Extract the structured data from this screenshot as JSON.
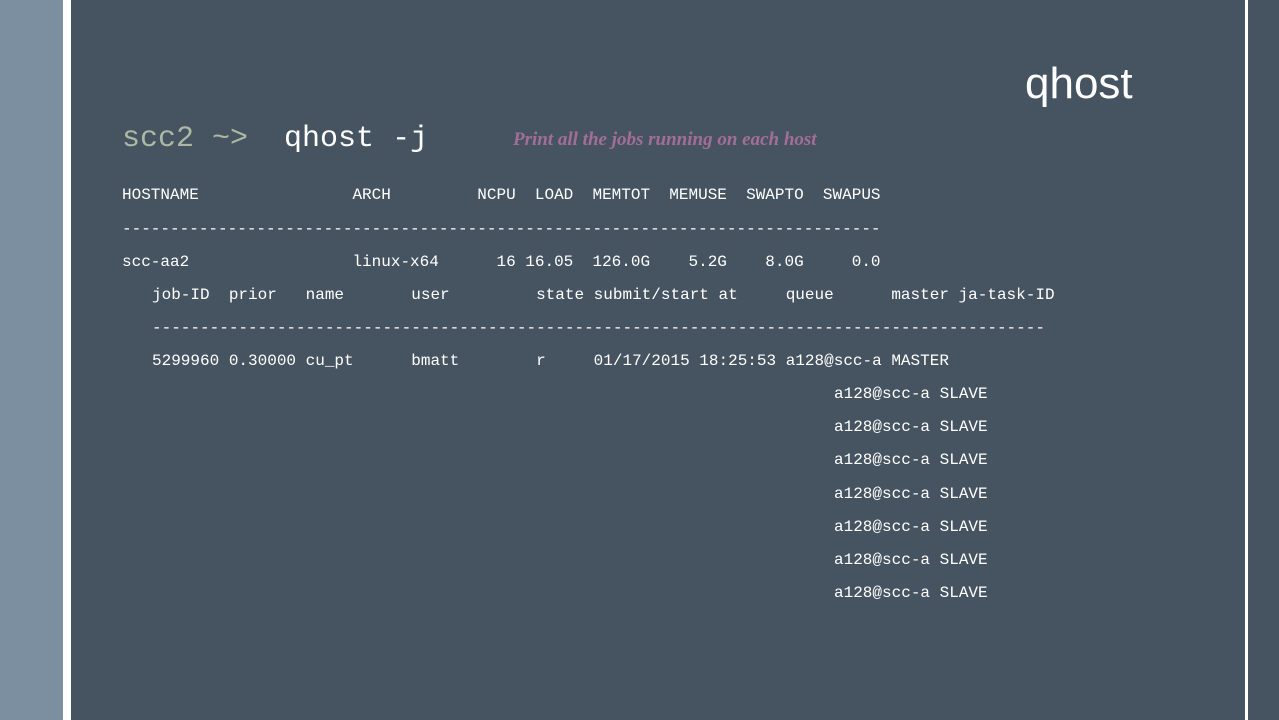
{
  "slide_title": "qhost",
  "command": {
    "prompt": "scc2 ~>",
    "text": "qhost -j",
    "note": "Print all the jobs running on each host"
  },
  "host_table": {
    "header": "HOSTNAME                ARCH         NCPU  LOAD  MEMTOT  MEMUSE  SWAPTO  SWAPUS",
    "divider": "-------------------------------------------------------------------------------",
    "row": "scc-aa2                 linux-x64      16 16.05  126.0G    5.2G    8.0G     0.0"
  },
  "job_table": {
    "header": "job-ID  prior   name       user         state submit/start at     queue      master ja-task-ID",
    "divider": "---------------------------------------------------------------------------------------------",
    "rows": [
      "5299960 0.30000 cu_pt      bmatt        r     01/17/2015 18:25:53 a128@scc-a MASTER",
      "a128@scc-a SLAVE",
      "a128@scc-a SLAVE",
      "a128@scc-a SLAVE",
      "a128@scc-a SLAVE",
      "a128@scc-a SLAVE",
      "a128@scc-a SLAVE",
      "a128@scc-a SLAVE"
    ]
  }
}
